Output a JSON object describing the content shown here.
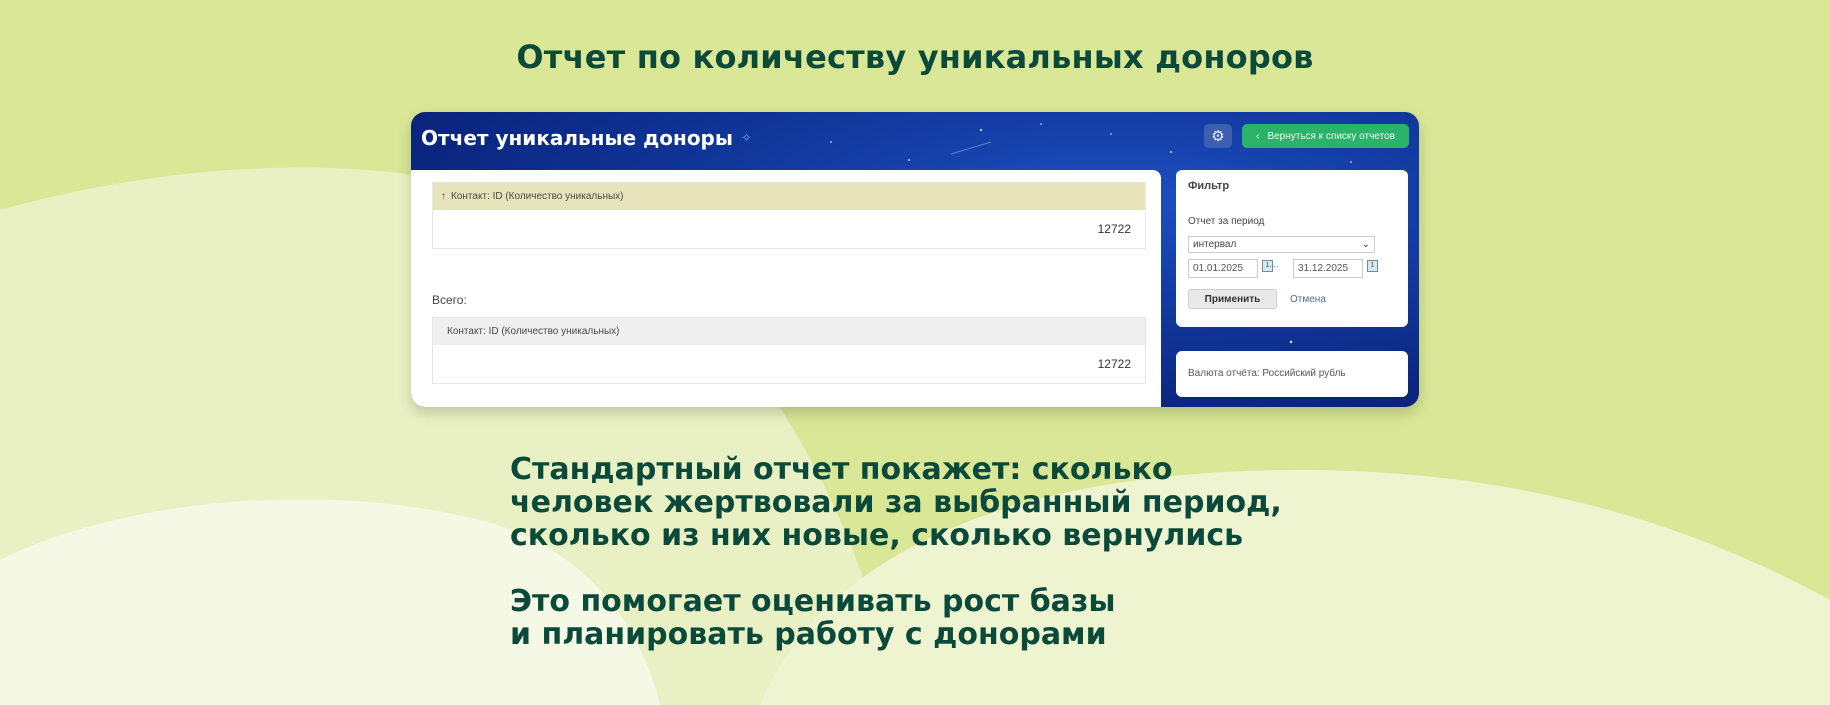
{
  "slide_title": "Отчет по количеству уникальных доноров",
  "window": {
    "title": "Отчет уникальные доноры",
    "back_button": "Вернуться к списку отчетов",
    "group_header": "Контакт: ID (Количество уникальных)",
    "group_value": "12722",
    "total_label": "Всего:",
    "total_header": "Контакт: ID (Количество уникальных)",
    "total_value": "12722",
    "filter": {
      "title": "Фильтр",
      "period_label": "Отчет за период",
      "period_value": "интервал",
      "date_from": "01.01.2025",
      "date_separator": "···",
      "date_to": "31.12.2025",
      "apply": "Применить",
      "cancel": "Отмена"
    },
    "currency": "Валюта отчёта: Российский рубль"
  },
  "body": {
    "p1": [
      "Стандартный отчет покажет: сколько",
      "человек жертвовали за выбранный период,",
      "сколько из них новые, сколько вернулись"
    ],
    "p2": [
      "Это помогает оценивать рост базы",
      "и планировать работу с донорами"
    ]
  },
  "colors": {
    "background": "#dbe89a",
    "text_dark_green": "#0b4a3a",
    "accent_green": "#2bb36a",
    "window_blue": "#123aa0"
  }
}
